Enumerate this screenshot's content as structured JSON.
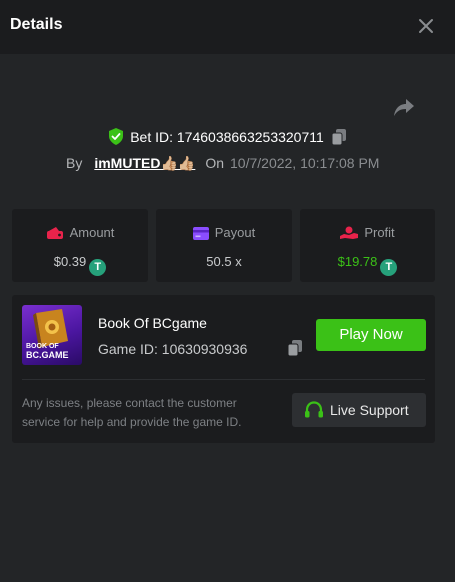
{
  "header": {
    "title": "Details",
    "close_icon": "close-icon"
  },
  "bet": {
    "share_icon": "share-arrow-icon",
    "verified_icon": "shield-check-icon",
    "bet_id_text": "Bet ID: 1746038663253320711",
    "copy_icon": "copy-icon",
    "by_label": "By",
    "username": "imMUTED👍🏼👍🏼",
    "on_label": "On",
    "date": "10/7/2022, 10:17:08 PM"
  },
  "stats": {
    "amount": {
      "label": "Amount",
      "value": "$0.39",
      "icon": "wallet-icon",
      "icon_color": "#e8234b"
    },
    "payout": {
      "label": "Payout",
      "value": "50.5 x",
      "icon": "card-icon",
      "icon_color": "#8a4dff"
    },
    "profit": {
      "label": "Profit",
      "value": "$19.78",
      "icon": "hand-coin-icon",
      "icon_color": "#e8234b",
      "value_color": "#3bc117"
    },
    "coin_symbol": "T"
  },
  "game": {
    "thumb_text_line1": "BOOK OF",
    "thumb_text_line2": "BC.GAME",
    "name": "Book Of BCgame",
    "game_id_text": "Game ID: 10630930936",
    "play_label": "Play Now",
    "play_color": "#3bc117"
  },
  "support": {
    "message": "Any issues, please contact the customer service for help and provide the game ID.",
    "live_label": "Live Support",
    "headset_icon": "headset-icon"
  }
}
